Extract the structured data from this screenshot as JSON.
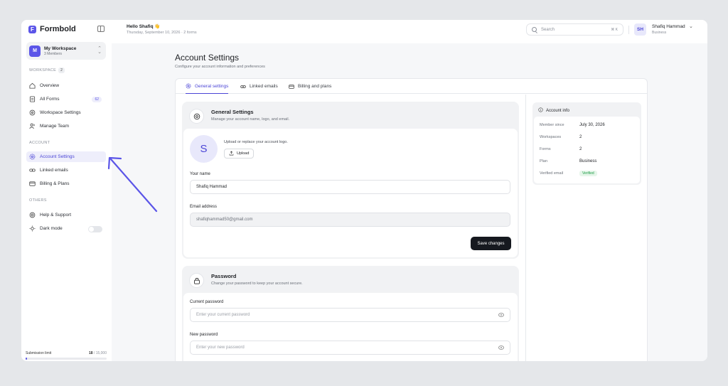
{
  "brand": {
    "name": "Formbold"
  },
  "workspace": {
    "initial": "M",
    "name": "My Workspace",
    "members": "3 Members"
  },
  "sidebar": {
    "workspace_label": "WORKSPACE",
    "workspace_count": "2",
    "account_label": "ACCOUNT",
    "others_label": "OTHERS",
    "items": [
      {
        "label": "Overview",
        "icon": "home-icon"
      },
      {
        "label": "All Forms",
        "icon": "form-icon",
        "badge": "62"
      },
      {
        "label": "Workspace Settings",
        "icon": "settings-icon"
      },
      {
        "label": "Manage Team",
        "icon": "team-icon"
      },
      {
        "label": "Account Settings",
        "icon": "gear-icon"
      },
      {
        "label": "Linked emails",
        "icon": "link-icon"
      },
      {
        "label": "Billing & Plans",
        "icon": "card-icon"
      },
      {
        "label": "Help & Support",
        "icon": "help-icon"
      },
      {
        "label": "Dark mode",
        "icon": "sun-icon"
      }
    ],
    "dark_mode_on": false,
    "submission_limit": {
      "label": "Submission limit",
      "used": "18",
      "total": "/ 15,000",
      "fraction": 0.0012
    }
  },
  "header": {
    "greeting": "Hello Shafiq 👋",
    "date_line": "Thursday, September 10, 2026 · 2 forms",
    "search_placeholder": "Search",
    "search_shortcut": "⌘ K",
    "user_initials": "SH",
    "user_name": "Shafiq Hammad",
    "user_plan": "Business"
  },
  "page": {
    "title": "Account Settings",
    "subtitle": "Configure your account information and preferences"
  },
  "tabs": [
    {
      "label": "General settings",
      "active": true
    },
    {
      "label": "Linked emails",
      "active": false
    },
    {
      "label": "Billing and plans",
      "active": false
    }
  ],
  "general": {
    "title": "General Settings",
    "desc": "Manage your account name, logo, and email.",
    "logo_initial": "S",
    "upload_text": "Upload or replace your account logo.",
    "upload_button": "Upload",
    "name_label": "Your name",
    "name_value": "Shafiq Hammad",
    "email_label": "Email address",
    "email_value": "shafiqhammad50@gmail.com",
    "save_button": "Save changes"
  },
  "password": {
    "title": "Password",
    "desc": "Change your password to keep your account secure.",
    "current_label": "Current password",
    "current_placeholder": "Enter your current password",
    "new_label": "New password",
    "new_placeholder": "Enter your new password"
  },
  "account_info": {
    "title": "Account info",
    "rows": [
      {
        "label": "Member since",
        "value": "July 30, 2026"
      },
      {
        "label": "Workspaces",
        "value": "2"
      },
      {
        "label": "Forms",
        "value": "2"
      },
      {
        "label": "Plan",
        "value": "Business"
      },
      {
        "label": "Verified email",
        "value": "Verified"
      }
    ]
  },
  "colors": {
    "accent": "#5b55e8",
    "arrow": "#5b55e8",
    "verified": "#1f9d47"
  }
}
